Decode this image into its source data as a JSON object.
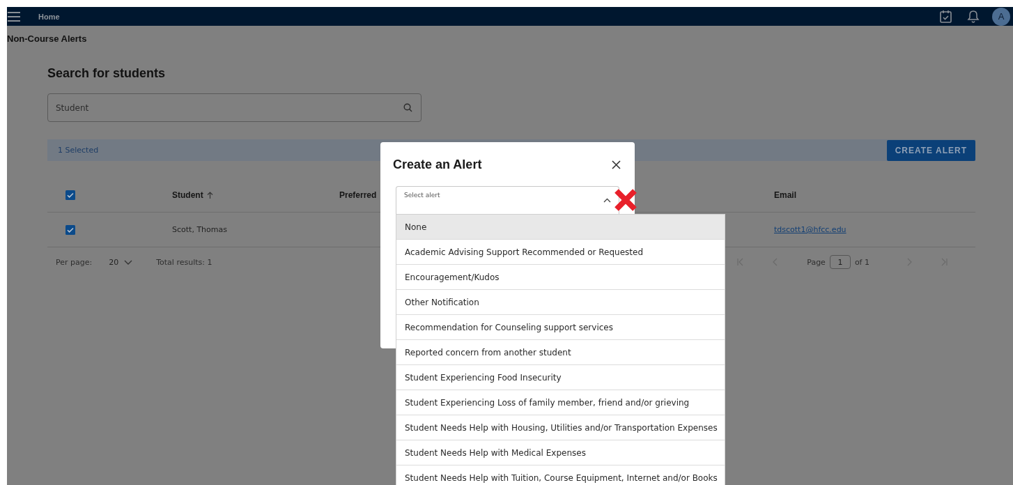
{
  "header": {
    "title": "Home",
    "avatar": "A"
  },
  "page_title": "Non-Course Alerts",
  "section_title": "Search for students",
  "search": {
    "placeholder": "Student"
  },
  "selection_bar": {
    "text": "1 Selected",
    "button": "CREATE ALERT"
  },
  "table": {
    "all_selected": true,
    "columns": [
      {
        "label": "Student",
        "sorted": true
      },
      {
        "label": "Preferred",
        "sorted": false
      },
      {
        "label": "Email",
        "sorted": false
      }
    ],
    "rows": [
      {
        "selected": true,
        "student": "Scott, Thomas",
        "email": "tdscott1@hfcc.edu"
      }
    ]
  },
  "pagination": {
    "per_page_label": "Per page:",
    "per_page": "20",
    "total": "Total results: 1",
    "page_label": "Page",
    "page": "1",
    "of": "of 1"
  },
  "dialog": {
    "title": "Create an Alert",
    "select": {
      "label": "Select alert",
      "expanded": true
    },
    "options": [
      {
        "label": "None",
        "selected": true
      },
      {
        "label": "Academic Advising Support Recommended or Requested",
        "selected": false
      },
      {
        "label": "Encouragement/Kudos",
        "selected": false
      },
      {
        "label": "Other Notification",
        "selected": false
      },
      {
        "label": "Recommendation for Counseling support services",
        "selected": false
      },
      {
        "label": "Reported concern from another student",
        "selected": false
      },
      {
        "label": "Student Experiencing Food Insecurity",
        "selected": false
      },
      {
        "label": "Student Experiencing Loss of family member, friend and/or grieving",
        "selected": false
      },
      {
        "label": "Student Needs Help with Housing, Utilities and/or Transportation Expenses",
        "selected": false
      },
      {
        "label": "Student Needs Help with Medical Expenses",
        "selected": false
      },
      {
        "label": "Student Needs Help with Tuition, Course Equipment, Internet and/or Books",
        "selected": false
      }
    ]
  }
}
